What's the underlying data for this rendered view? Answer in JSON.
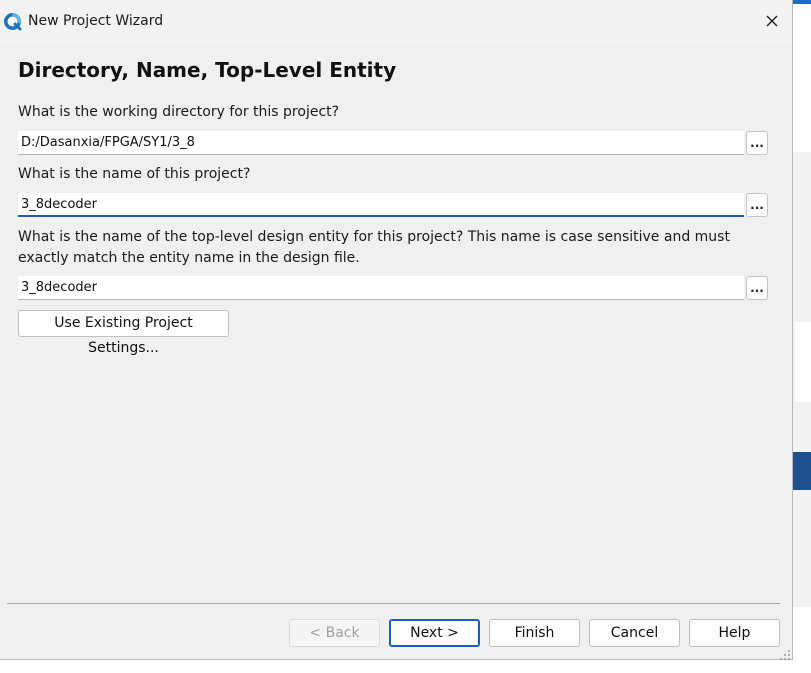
{
  "window": {
    "title": "New Project Wizard",
    "icon": "quartus-logo-icon",
    "close_icon": "close-icon"
  },
  "page": {
    "heading": "Directory, Name, Top-Level Entity"
  },
  "fields": {
    "directory": {
      "label": "What is the working directory for this project?",
      "value": "D:/Dasanxia/FPGA/SY1/3_8",
      "browse_label": "..."
    },
    "project_name": {
      "label": "What is the name of this project?",
      "value": "3_8decoder",
      "browse_label": "..."
    },
    "top_level": {
      "label": "What is the name of the top-level design entity for this project? This name is case sensitive and must exactly match the entity name in the design file.",
      "value": "3_8decoder",
      "browse_label": "..."
    }
  },
  "buttons": {
    "use_existing": "Use Existing Project Settings...",
    "back": "< Back",
    "next": "Next >",
    "finish": "Finish",
    "cancel": "Cancel",
    "help": "Help"
  },
  "colors": {
    "dialog_bg": "#f0f0f0",
    "focus_accent": "#1a5fb4",
    "disabled_text": "#a0a0a0"
  }
}
